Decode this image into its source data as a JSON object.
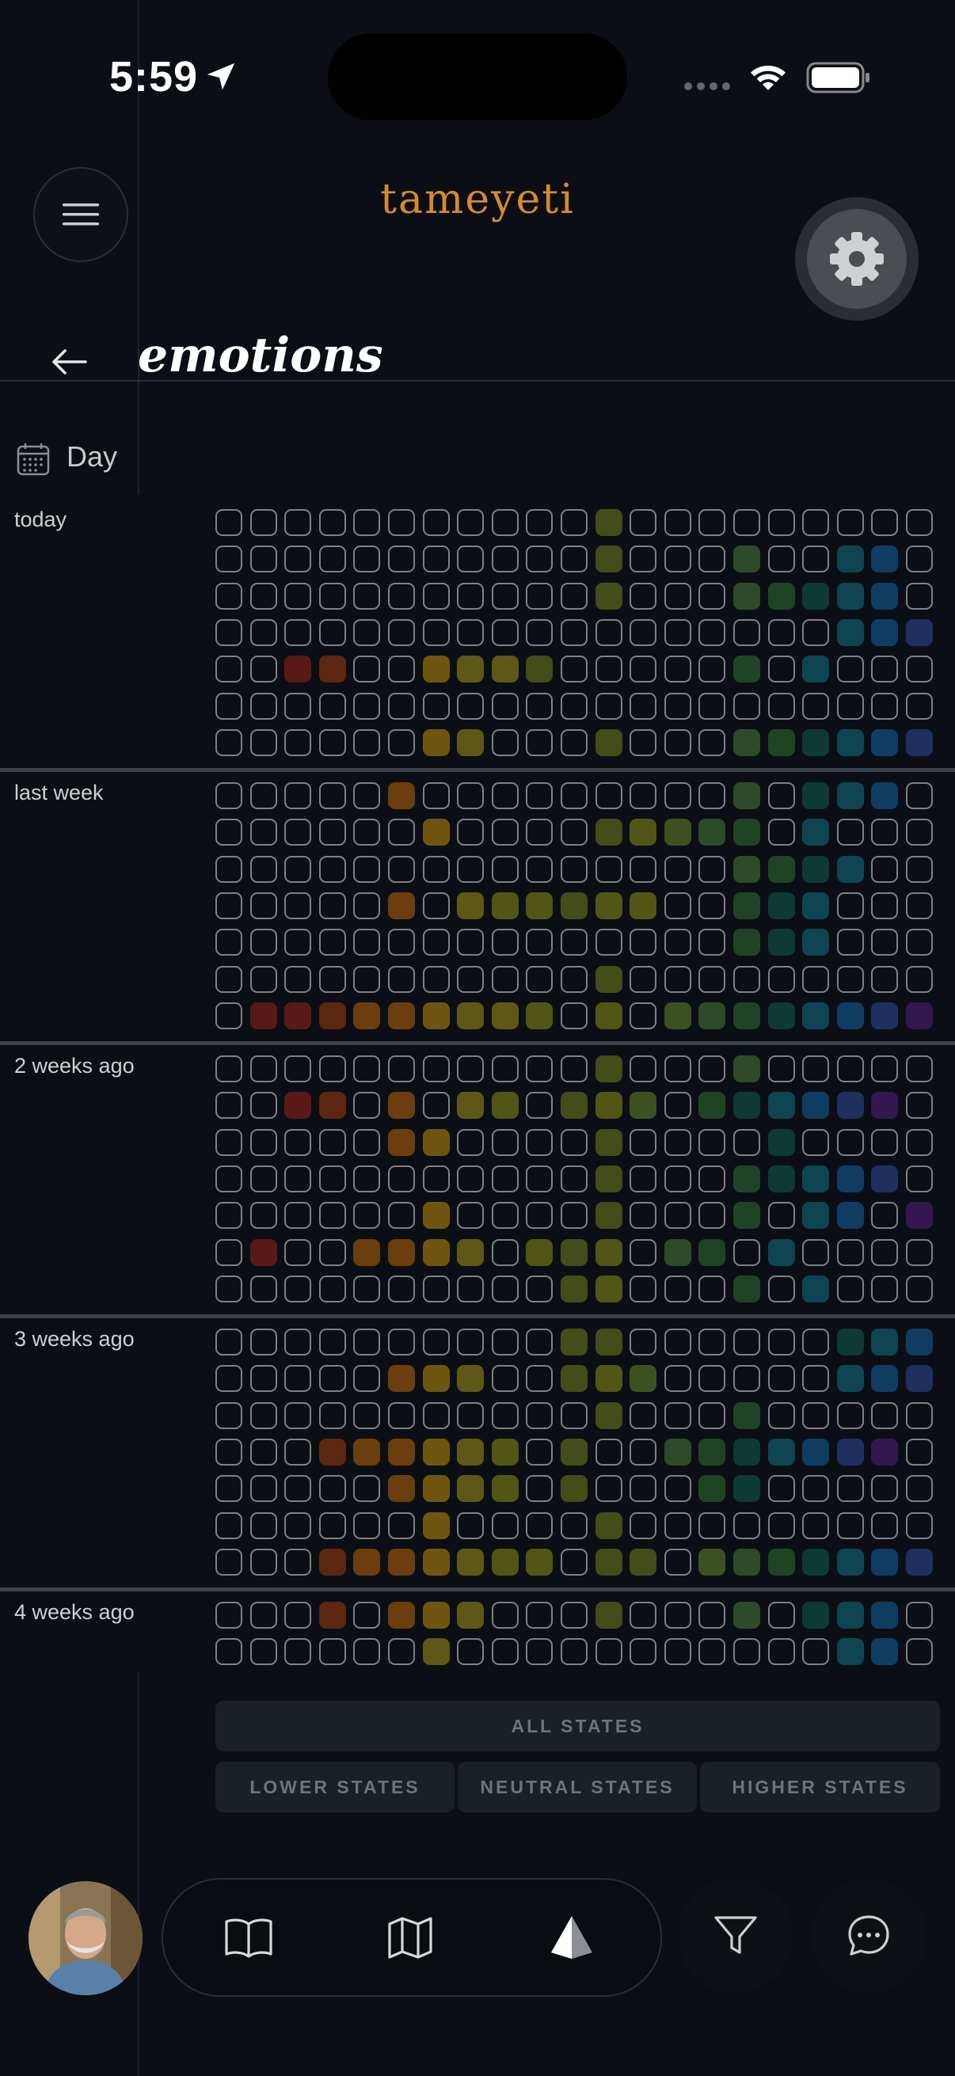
{
  "status_bar": {
    "time": "5:59"
  },
  "header": {
    "brand": "tameyeti"
  },
  "page": {
    "title": "emotions",
    "period_label": "Day"
  },
  "colors": {
    "a": "#5a1919",
    "b": "#5c2711",
    "c": "#6a3e0e",
    "d": "#6e560e",
    "e": "#5e5818",
    "f": "#515616",
    "g": "#444c1a",
    "h": "#3e5022",
    "i": "#2d4a2a",
    "j": "#214325",
    "k": "#0f3a34",
    "l": "#0e4550",
    "m": "#113c61",
    "n": "#1f305e",
    "o": "#33184f"
  },
  "heatmap": {
    "rows": 7,
    "cols": 21,
    "sections": [
      {
        "label": "today",
        "rows": [
          "...........g.........",
          "...........g...i..lm.",
          "...........g...ijklm.",
          "..................lmno",
          "..ab..deeg.....j.l...",
          ".....................",
          "......de...g...ijklmno"
        ]
      },
      {
        "label": "last week",
        "rows": [
          ".....c.........i.klm.",
          "......d....gfhij.l...",
          "...............ijkl..",
          ".....c.effgff..jkl...",
          "...............jkl...",
          "...........g.........",
          ".aabccdeef.f.hijklmno"
        ]
      },
      {
        "label": "2 weeks ago",
        "rows": [
          "...........g...i.....",
          "..ab.c.ef.gfh.jklmno.",
          ".....cd....g....k....",
          "...........g...jklmn.",
          "......d....g...j.lm.o",
          ".a..ccde.fgf.ij.l....",
          "..........gf...j.l...."
        ]
      },
      {
        "label": "3 weeks ago",
        "rows": [
          "..........gg......klm..",
          ".....cde..gfh.....lmno",
          "...........g...j......",
          "...bccdef.g..ijklmno",
          ".....cdef.g...jk.....",
          "......d....g..........",
          "...bccdeff.gg.hijklmno"
        ]
      },
      {
        "label": "4 weeks ago",
        "rows": [
          "...b.cde...g...i.klm..",
          "......e...........lm.o"
        ]
      }
    ]
  },
  "filters": {
    "all": "ALL STATES",
    "lower": "LOWER STATES",
    "neutral": "NEUTRAL STATES",
    "higher": "HIGHER STATES"
  },
  "nav": {
    "icons": [
      "book-icon",
      "map-icon",
      "prism-icon",
      "filter-icon",
      "chat-icon"
    ]
  }
}
